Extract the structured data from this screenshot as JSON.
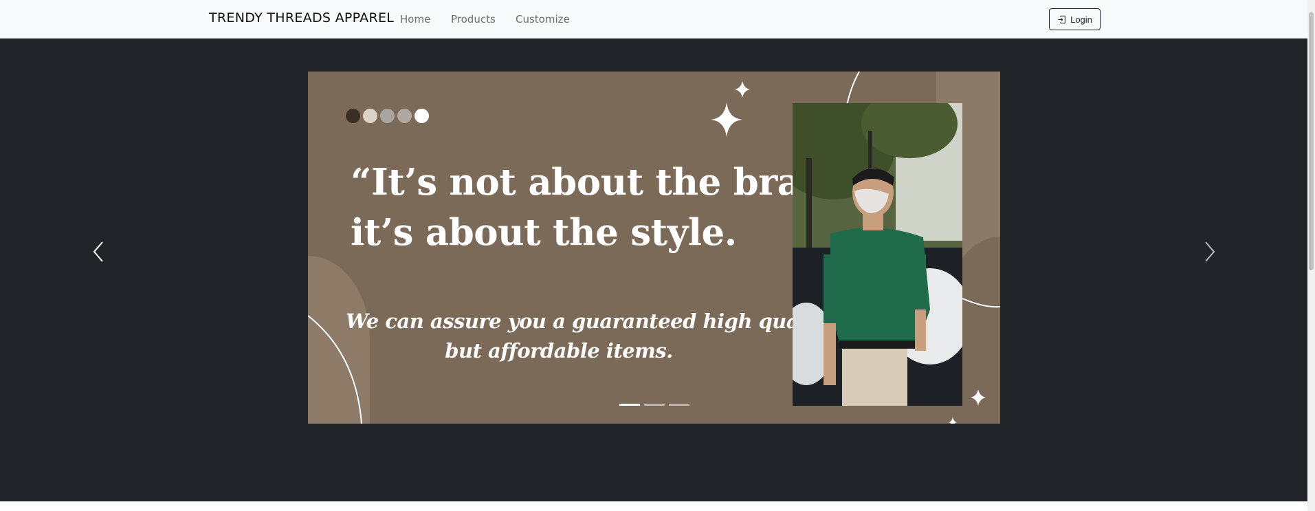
{
  "navbar": {
    "brand": "TRENDY THREADS APPAREL",
    "links": [
      "Home",
      "Products",
      "Customize"
    ],
    "login_label": "Login",
    "login_icon": "box-arrow-in-right-icon"
  },
  "carousel": {
    "prev_icon": "chevron-left-icon",
    "next_icon": "chevron-right-icon",
    "active_slide": 1,
    "slide_count": 3,
    "slide": {
      "quote_lines": [
        "“It’s not about the brand,",
        "it’s about the style."
      ],
      "subtitle_lines": [
        "We can assure you a guaranteed high quality",
        "but affordable items."
      ],
      "palette_dots": [
        "#3a2e25",
        "#ddd3c7",
        "#a9a6a2",
        "#b0a9a1",
        "#ffffff"
      ]
    }
  },
  "colors": {
    "navbar_bg": "#f8f9fa",
    "carousel_bg": "#212529",
    "slide_bg": "#7b6a58",
    "accent_text": "#ffffff"
  }
}
